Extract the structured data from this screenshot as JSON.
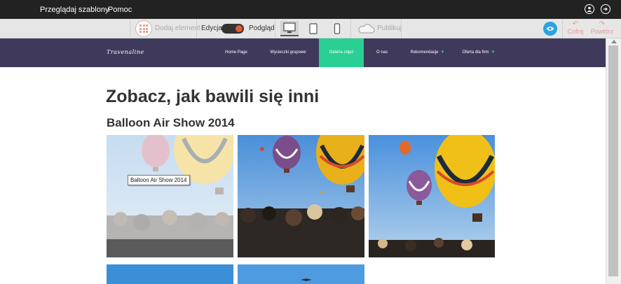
{
  "topbar": {
    "browse_label": "Przeglądaj szablony",
    "help_label": "Pomoc",
    "account_icon": "user-icon",
    "logout_icon": "logout-icon"
  },
  "toolbar": {
    "add_element_label": "Dodaj element",
    "edit_label": "Edycja",
    "preview_label": "Podgląd",
    "publish_label": "Publikuj",
    "undo_label": "Cofnij",
    "redo_label": "Powtórz",
    "active_device": "desktop",
    "accent_color": "#e05c2e",
    "eye_color": "#2aa2e4"
  },
  "site": {
    "brand": "Travenaline",
    "nav": [
      {
        "label": "Home Page",
        "dropdown": false
      },
      {
        "label": "Wycieczki grupowe",
        "dropdown": false
      },
      {
        "label": "Galeria zdjęć",
        "dropdown": false,
        "active": true
      },
      {
        "label": "O nas",
        "dropdown": false
      },
      {
        "label": "Rekomendacje",
        "dropdown": true
      },
      {
        "label": "Oferta dla firm",
        "dropdown": true
      }
    ],
    "nav_bg": "#3f3a5c",
    "nav_active": "#29cf93"
  },
  "content": {
    "title": "Zobacz, jak bawili się inni",
    "subtitle": "Balloon Air Show 2014",
    "tooltip": "Balloon Air Show 2014"
  }
}
